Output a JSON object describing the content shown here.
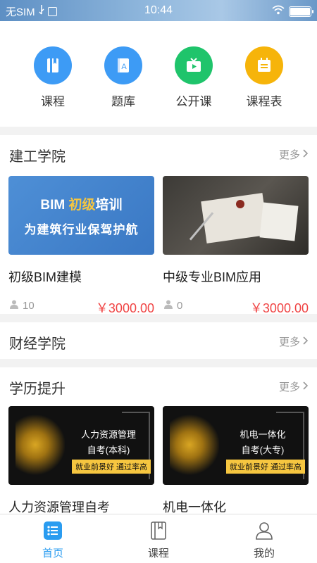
{
  "status_bar": {
    "carrier": "无SIM",
    "time": "10:44"
  },
  "quick_nav": [
    {
      "label": "课程",
      "icon": "book-icon",
      "color": "#3d9bf5"
    },
    {
      "label": "题库",
      "icon": "question-bank-icon",
      "color": "#3d9bf5"
    },
    {
      "label": "公开课",
      "icon": "tv-play-icon",
      "color": "#1fc46b"
    },
    {
      "label": "课程表",
      "icon": "schedule-icon",
      "color": "#f6b40a"
    }
  ],
  "sections": {
    "jiangong": {
      "title": "建工学院",
      "more": "更多",
      "cards": [
        {
          "title": "初级BIM建模",
          "count": "10",
          "price": "￥3000.00",
          "banner_line1_a": "BIM ",
          "banner_line1_b": "初级",
          "banner_line1_c": "培训",
          "banner_line2": "为建筑行业保驾护航"
        },
        {
          "title": "中级专业BIM应用",
          "count": "0",
          "price": "￥3000.00"
        }
      ]
    },
    "caijing": {
      "title": "财经学院",
      "more": "更多"
    },
    "xueli": {
      "title": "学历提升",
      "more": "更多",
      "cards": [
        {
          "title": "人力资源管理自考",
          "banner_line1": "人力资源管理",
          "banner_line2": "自考(本科)",
          "banner_tag": "就业前景好 通过率高"
        },
        {
          "title": "机电一体化",
          "banner_line1": "机电一体化",
          "banner_line2": "自考(大专)",
          "banner_tag": "就业前景好 通过率高"
        }
      ]
    }
  },
  "tab_bar": [
    {
      "label": "首页",
      "active": true
    },
    {
      "label": "课程",
      "active": false
    },
    {
      "label": "我的",
      "active": false
    }
  ],
  "colors": {
    "accent": "#2a9cf0",
    "price": "#f04343"
  }
}
